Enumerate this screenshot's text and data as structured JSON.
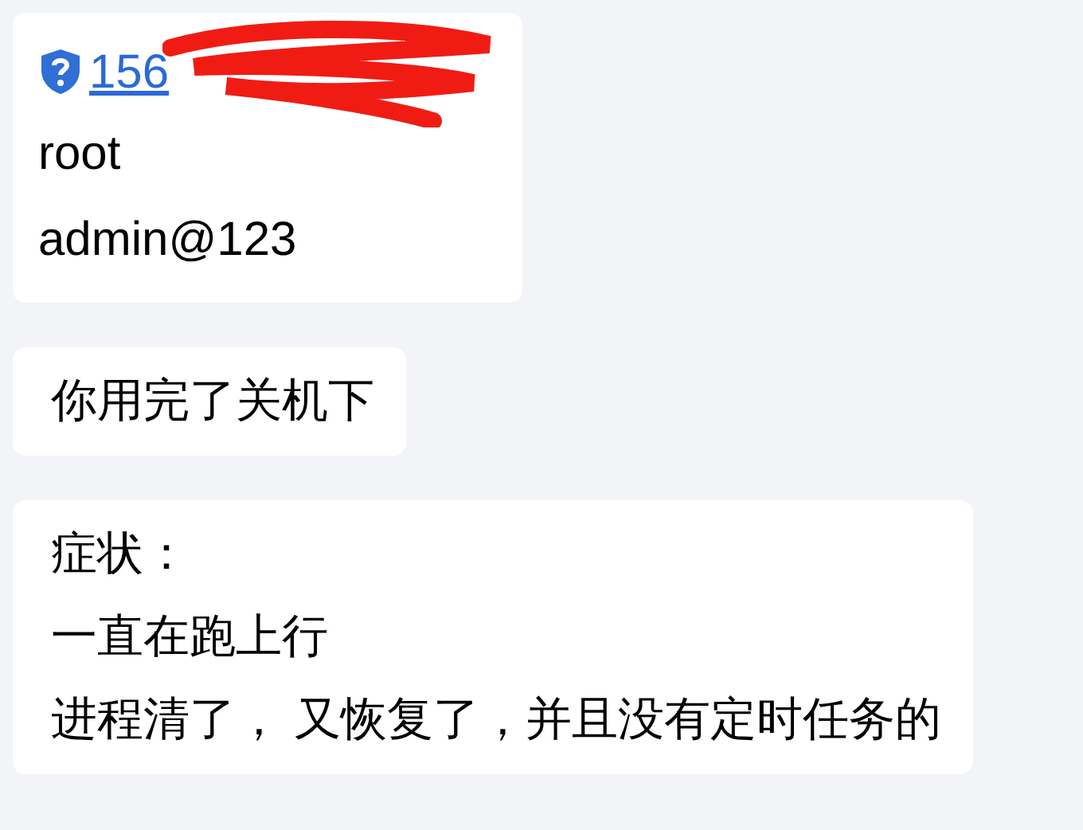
{
  "messages": [
    {
      "kind": "contact",
      "link": "156",
      "lines": [
        "root",
        "admin@123"
      ]
    },
    {
      "kind": "text",
      "lines": [
        "你用完了关机下"
      ]
    },
    {
      "kind": "text",
      "lines": [
        "症状：",
        "一直在跑上行",
        "进程清了， 又恢复了，并且没有定时任务的"
      ]
    }
  ]
}
